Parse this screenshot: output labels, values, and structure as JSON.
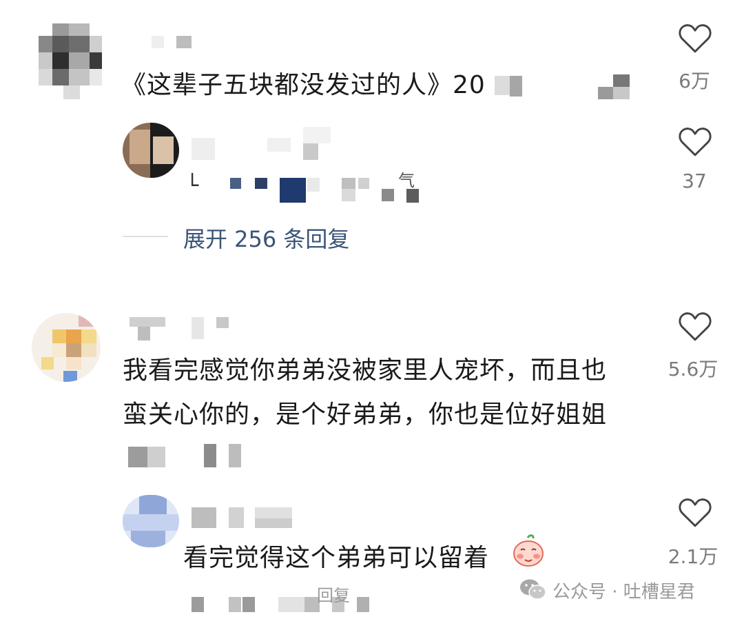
{
  "comments": [
    {
      "text": "《这辈子五块都没发过的人》20",
      "likes": "6万"
    },
    {
      "text_fragment": "气",
      "likes": "37",
      "expand_label": "展开 256 条回复"
    },
    {
      "text_line1": "我看完感觉你弟弟没被家里人宠坏，而且也",
      "text_line2": "蛮关心你的，是个好弟弟，你也是位好姐姐",
      "likes": "5.6万"
    },
    {
      "text": "看完觉得这个弟弟可以留着",
      "likes": "2.1万",
      "reply_fragment": "回复"
    }
  ],
  "watermark": {
    "text": "公众号 · 吐槽星君",
    "icon": "wechat-icon"
  },
  "icons": {
    "like": "heart-outline-icon",
    "emoji": "pig-blush-emoji-icon"
  }
}
